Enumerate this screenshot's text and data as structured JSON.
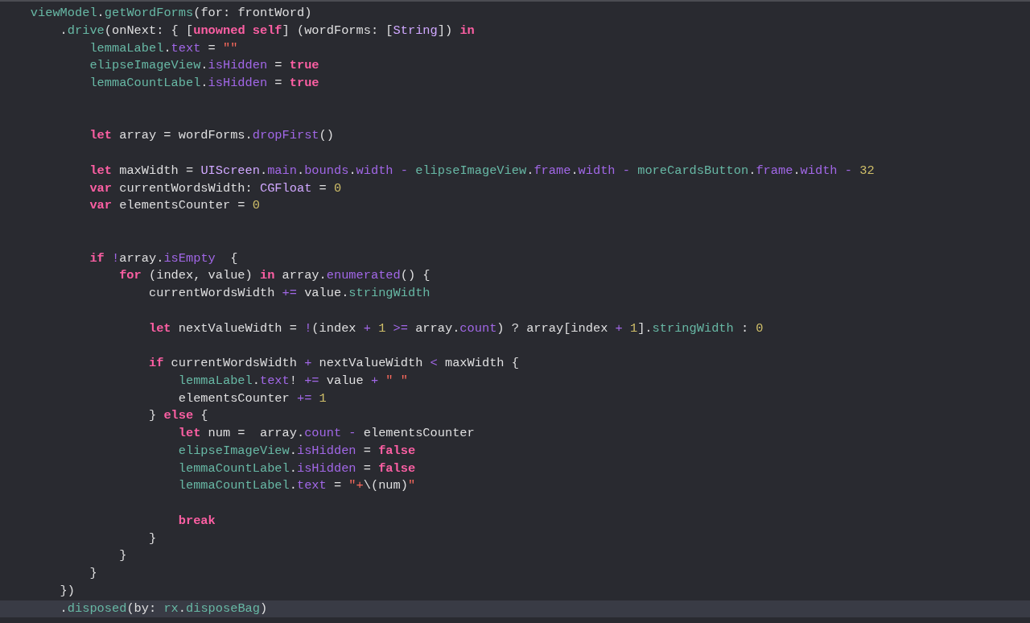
{
  "editor": {
    "lines": [
      {
        "highlighted": false,
        "tokens": [
          {
            "text": "    viewModel",
            "kind": "proj"
          },
          {
            "text": ".",
            "kind": "plain"
          },
          {
            "text": "getWordForms",
            "kind": "proj"
          },
          {
            "text": "(for: frontWord)",
            "kind": "plain"
          }
        ]
      },
      {
        "highlighted": false,
        "tokens": [
          {
            "text": "        .",
            "kind": "plain"
          },
          {
            "text": "drive",
            "kind": "proj"
          },
          {
            "text": "(onNext: { [",
            "kind": "plain"
          },
          {
            "text": "unowned",
            "kind": "kw"
          },
          {
            "text": " self",
            "kind": "kw"
          },
          {
            "text": "] (wordForms: [",
            "kind": "plain"
          },
          {
            "text": "String",
            "kind": "type"
          },
          {
            "text": "]) ",
            "kind": "plain"
          },
          {
            "text": "in",
            "kind": "kw"
          }
        ]
      },
      {
        "highlighted": false,
        "tokens": [
          {
            "text": "            lemmaLabel",
            "kind": "proj"
          },
          {
            "text": ".",
            "kind": "plain"
          },
          {
            "text": "text",
            "kind": "sys"
          },
          {
            "text": " = ",
            "kind": "plain"
          },
          {
            "text": "\"\"",
            "kind": "str"
          }
        ]
      },
      {
        "highlighted": false,
        "tokens": [
          {
            "text": "            elipseImageView",
            "kind": "proj"
          },
          {
            "text": ".",
            "kind": "plain"
          },
          {
            "text": "isHidden",
            "kind": "sys"
          },
          {
            "text": " = ",
            "kind": "plain"
          },
          {
            "text": "true",
            "kind": "kw"
          }
        ]
      },
      {
        "highlighted": false,
        "tokens": [
          {
            "text": "            lemmaCountLabel",
            "kind": "proj"
          },
          {
            "text": ".",
            "kind": "plain"
          },
          {
            "text": "isHidden",
            "kind": "sys"
          },
          {
            "text": " = ",
            "kind": "plain"
          },
          {
            "text": "true",
            "kind": "kw"
          }
        ]
      },
      {
        "highlighted": false
      },
      {
        "highlighted": false
      },
      {
        "highlighted": false,
        "tokens": [
          {
            "text": "            let",
            "kind": "kw"
          },
          {
            "text": " array = wordForms.",
            "kind": "plain"
          },
          {
            "text": "dropFirst",
            "kind": "sys"
          },
          {
            "text": "()",
            "kind": "plain"
          }
        ]
      },
      {
        "highlighted": false
      },
      {
        "highlighted": false,
        "tokens": [
          {
            "text": "            let",
            "kind": "kw"
          },
          {
            "text": " maxWidth = ",
            "kind": "plain"
          },
          {
            "text": "UIScreen",
            "kind": "type"
          },
          {
            "text": ".",
            "kind": "plain"
          },
          {
            "text": "main",
            "kind": "sys"
          },
          {
            "text": ".",
            "kind": "plain"
          },
          {
            "text": "bounds",
            "kind": "sys"
          },
          {
            "text": ".",
            "kind": "plain"
          },
          {
            "text": "width",
            "kind": "sys"
          },
          {
            "text": " - ",
            "kind": "sys"
          },
          {
            "text": "elipseImageView",
            "kind": "proj"
          },
          {
            "text": ".",
            "kind": "plain"
          },
          {
            "text": "frame",
            "kind": "sys"
          },
          {
            "text": ".",
            "kind": "plain"
          },
          {
            "text": "width",
            "kind": "sys"
          },
          {
            "text": " - ",
            "kind": "sys"
          },
          {
            "text": "moreCardsButton",
            "kind": "proj"
          },
          {
            "text": ".",
            "kind": "plain"
          },
          {
            "text": "frame",
            "kind": "sys"
          },
          {
            "text": ".",
            "kind": "plain"
          },
          {
            "text": "width",
            "kind": "sys"
          },
          {
            "text": " - ",
            "kind": "sys"
          },
          {
            "text": "32",
            "kind": "num"
          }
        ]
      },
      {
        "highlighted": false,
        "tokens": [
          {
            "text": "            var",
            "kind": "kw"
          },
          {
            "text": " currentWordsWidth: ",
            "kind": "plain"
          },
          {
            "text": "CGFloat",
            "kind": "type"
          },
          {
            "text": " = ",
            "kind": "plain"
          },
          {
            "text": "0",
            "kind": "num"
          }
        ]
      },
      {
        "highlighted": false,
        "tokens": [
          {
            "text": "            var",
            "kind": "kw"
          },
          {
            "text": " elementsCounter = ",
            "kind": "plain"
          },
          {
            "text": "0",
            "kind": "num"
          }
        ]
      },
      {
        "highlighted": false
      },
      {
        "highlighted": false
      },
      {
        "highlighted": false,
        "tokens": [
          {
            "text": "            if",
            "kind": "kw"
          },
          {
            "text": " !",
            "kind": "sys"
          },
          {
            "text": "array.",
            "kind": "plain"
          },
          {
            "text": "isEmpty",
            "kind": "sys"
          },
          {
            "text": "  {",
            "kind": "plain"
          }
        ]
      },
      {
        "highlighted": false,
        "tokens": [
          {
            "text": "                for",
            "kind": "kw"
          },
          {
            "text": " (index, value) ",
            "kind": "plain"
          },
          {
            "text": "in",
            "kind": "kw"
          },
          {
            "text": " array.",
            "kind": "plain"
          },
          {
            "text": "enumerated",
            "kind": "sys"
          },
          {
            "text": "() {",
            "kind": "plain"
          }
        ]
      },
      {
        "highlighted": false,
        "tokens": [
          {
            "text": "                    currentWordsWidth ",
            "kind": "plain"
          },
          {
            "text": "+=",
            "kind": "sys"
          },
          {
            "text": " value.",
            "kind": "plain"
          },
          {
            "text": "stringWidth",
            "kind": "proj"
          }
        ]
      },
      {
        "highlighted": false
      },
      {
        "highlighted": false,
        "tokens": [
          {
            "text": "                    let",
            "kind": "kw"
          },
          {
            "text": " nextValueWidth = ",
            "kind": "plain"
          },
          {
            "text": "!",
            "kind": "sys"
          },
          {
            "text": "(index ",
            "kind": "plain"
          },
          {
            "text": "+ ",
            "kind": "sys"
          },
          {
            "text": "1",
            "kind": "num"
          },
          {
            "text": " >=",
            "kind": "sys"
          },
          {
            "text": " array.",
            "kind": "plain"
          },
          {
            "text": "count",
            "kind": "sys"
          },
          {
            "text": ") ? array[index ",
            "kind": "plain"
          },
          {
            "text": "+ ",
            "kind": "sys"
          },
          {
            "text": "1",
            "kind": "num"
          },
          {
            "text": "].",
            "kind": "plain"
          },
          {
            "text": "stringWidth",
            "kind": "proj"
          },
          {
            "text": " : ",
            "kind": "plain"
          },
          {
            "text": "0",
            "kind": "num"
          }
        ]
      },
      {
        "highlighted": false
      },
      {
        "highlighted": false,
        "tokens": [
          {
            "text": "                    if",
            "kind": "kw"
          },
          {
            "text": " currentWordsWidth ",
            "kind": "plain"
          },
          {
            "text": "+",
            "kind": "sys"
          },
          {
            "text": " nextValueWidth ",
            "kind": "plain"
          },
          {
            "text": "<",
            "kind": "sys"
          },
          {
            "text": " maxWidth {",
            "kind": "plain"
          }
        ]
      },
      {
        "highlighted": false,
        "tokens": [
          {
            "text": "                        lemmaLabel",
            "kind": "proj"
          },
          {
            "text": ".",
            "kind": "plain"
          },
          {
            "text": "text",
            "kind": "sys"
          },
          {
            "text": "! ",
            "kind": "plain"
          },
          {
            "text": "+=",
            "kind": "sys"
          },
          {
            "text": " value ",
            "kind": "plain"
          },
          {
            "text": "+ ",
            "kind": "sys"
          },
          {
            "text": "\" \"",
            "kind": "str"
          }
        ]
      },
      {
        "highlighted": false,
        "tokens": [
          {
            "text": "                        elementsCounter ",
            "kind": "plain"
          },
          {
            "text": "+= ",
            "kind": "sys"
          },
          {
            "text": "1",
            "kind": "num"
          }
        ]
      },
      {
        "highlighted": false,
        "tokens": [
          {
            "text": "                    } ",
            "kind": "plain"
          },
          {
            "text": "else",
            "kind": "kw"
          },
          {
            "text": " {",
            "kind": "plain"
          }
        ]
      },
      {
        "highlighted": false,
        "tokens": [
          {
            "text": "                        let",
            "kind": "kw"
          },
          {
            "text": " num =  array.",
            "kind": "plain"
          },
          {
            "text": "count",
            "kind": "sys"
          },
          {
            "text": " -",
            "kind": "sys"
          },
          {
            "text": " elementsCounter",
            "kind": "plain"
          }
        ]
      },
      {
        "highlighted": false,
        "tokens": [
          {
            "text": "                        elipseImageView",
            "kind": "proj"
          },
          {
            "text": ".",
            "kind": "plain"
          },
          {
            "text": "isHidden",
            "kind": "sys"
          },
          {
            "text": " = ",
            "kind": "plain"
          },
          {
            "text": "false",
            "kind": "kw"
          }
        ]
      },
      {
        "highlighted": false,
        "tokens": [
          {
            "text": "                        lemmaCountLabel",
            "kind": "proj"
          },
          {
            "text": ".",
            "kind": "plain"
          },
          {
            "text": "isHidden",
            "kind": "sys"
          },
          {
            "text": " = ",
            "kind": "plain"
          },
          {
            "text": "false",
            "kind": "kw"
          }
        ]
      },
      {
        "highlighted": false,
        "tokens": [
          {
            "text": "                        lemmaCountLabel",
            "kind": "proj"
          },
          {
            "text": ".",
            "kind": "plain"
          },
          {
            "text": "text",
            "kind": "sys"
          },
          {
            "text": " = ",
            "kind": "plain"
          },
          {
            "text": "\"+",
            "kind": "str"
          },
          {
            "text": "\\(num)",
            "kind": "plain"
          },
          {
            "text": "\"",
            "kind": "str"
          }
        ]
      },
      {
        "highlighted": false
      },
      {
        "highlighted": false,
        "tokens": [
          {
            "text": "                        break",
            "kind": "kw"
          }
        ]
      },
      {
        "highlighted": false,
        "tokens": [
          {
            "text": "                    }",
            "kind": "plain"
          }
        ]
      },
      {
        "highlighted": false,
        "tokens": [
          {
            "text": "                }",
            "kind": "plain"
          }
        ]
      },
      {
        "highlighted": false,
        "tokens": [
          {
            "text": "            }",
            "kind": "plain"
          }
        ]
      },
      {
        "highlighted": false,
        "tokens": [
          {
            "text": "        })",
            "kind": "plain"
          }
        ]
      },
      {
        "highlighted": true,
        "tokens": [
          {
            "text": "        .",
            "kind": "plain"
          },
          {
            "text": "disposed",
            "kind": "proj"
          },
          {
            "text": "(by: ",
            "kind": "plain"
          },
          {
            "text": "rx",
            "kind": "proj"
          },
          {
            "text": ".",
            "kind": "plain"
          },
          {
            "text": "disposeBag",
            "kind": "proj"
          },
          {
            "text": ")",
            "kind": "plain"
          }
        ]
      }
    ]
  }
}
